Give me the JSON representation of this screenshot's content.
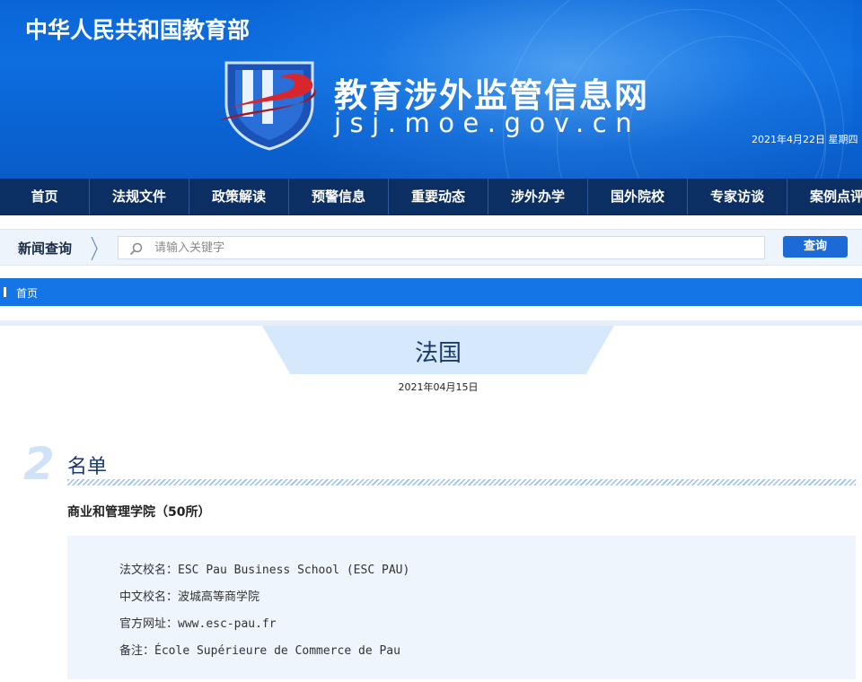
{
  "header": {
    "ministry": "中华人民共和国教育部",
    "site_title": "教育涉外监管信息网",
    "site_domain": "jsj.moe.gov.cn",
    "date_text": "2021年4月22日  星期四"
  },
  "nav": {
    "items": [
      "首页",
      "法规文件",
      "政策解读",
      "预警信息",
      "重要动态",
      "涉外办学",
      "国外院校",
      "专家访谈",
      "案例点评"
    ]
  },
  "search": {
    "label": "新闻查询",
    "placeholder": "请输入关键字",
    "button": "查询"
  },
  "breadcrumb": {
    "home": "首页"
  },
  "article": {
    "title": "法国",
    "date": "2021年04月15日"
  },
  "section": {
    "number": "2",
    "title": "名单",
    "category": "商业和管理学院（50所）"
  },
  "school": {
    "rows": [
      {
        "label": "法文校名：",
        "value": "ESC Pau Business School (ESC PAU)"
      },
      {
        "label": "中文校名：",
        "value": "波城高等商学院"
      },
      {
        "label": "官方网址：",
        "value": "www.esc-pau.fr"
      },
      {
        "label": "备注：",
        "value": "École Supérieure de Commerce de Pau"
      }
    ]
  },
  "colors": {
    "header_blue": "#0a66d6",
    "nav_navy": "#0c2f63",
    "breadcrumb_blue": "#1476e6",
    "button_blue": "#1b6ad8",
    "logo_red": "#d9262c"
  }
}
